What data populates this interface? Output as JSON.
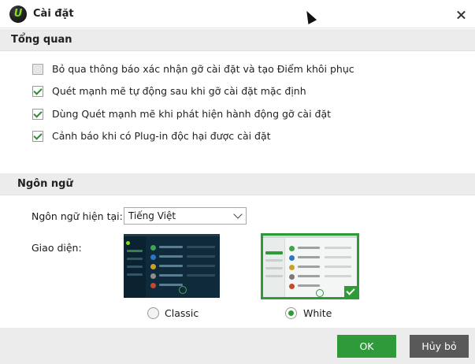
{
  "window": {
    "title": "Cài đặt"
  },
  "general": {
    "header": "Tổng quan",
    "options": [
      {
        "label": "Bỏ qua thông báo xác nhận gỡ cài đặt và tạo Điểm khôi phục",
        "checked": false
      },
      {
        "label": "Quét mạnh mẽ tự động sau khi gỡ cài đặt mặc định",
        "checked": true
      },
      {
        "label": "Dùng Quét mạnh mẽ khi phát hiện hành động gỡ cài đặt",
        "checked": true
      },
      {
        "label": "Cảnh báo khi có Plug-in độc hại được cài đặt",
        "checked": true
      }
    ]
  },
  "language": {
    "header": "Ngôn ngữ",
    "current_label": "Ngôn ngữ hiện tại:",
    "current_value": "Tiếng Việt",
    "theme_label": "Giao diện:",
    "themes": [
      {
        "label": "Classic",
        "selected": false
      },
      {
        "label": "White",
        "selected": true
      }
    ]
  },
  "footer": {
    "ok_label": "OK",
    "cancel_label": "Hủy bỏ"
  },
  "colors": {
    "accent": "#2e9a3a",
    "cancel": "#595959",
    "section_bg": "#ececec"
  }
}
